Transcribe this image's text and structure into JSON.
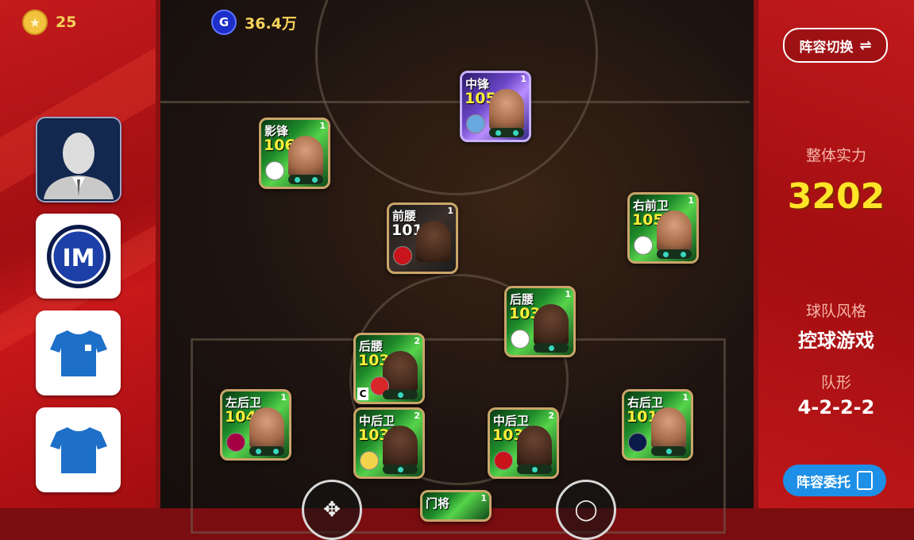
{
  "currency": {
    "coins": {
      "icon": "star-coin-icon",
      "value": "25"
    },
    "gp": {
      "icon": "gp-icon",
      "symbol": "G",
      "value": "36.4万"
    }
  },
  "left_menu": [
    {
      "name": "manager",
      "icon": "manager-silhouette-icon"
    },
    {
      "name": "club-crest",
      "icon": "inter-crest-icon"
    },
    {
      "name": "home-kit",
      "icon": "shirt-icon"
    },
    {
      "name": "away-kit",
      "icon": "shirt-icon"
    }
  ],
  "right_panel": {
    "switch_label": "阵容切换",
    "overall_label": "整体实力",
    "overall_value": "3202",
    "style_label": "球队风格",
    "style_value": "控球游戏",
    "formation_label": "队形",
    "formation_value": "4-2-2-2",
    "delegate_label": "阵容委托"
  },
  "players": [
    {
      "id": "cf",
      "position": "中锋",
      "rating": "105",
      "level": "1",
      "style": "purple"
    },
    {
      "id": "ss",
      "position": "影锋",
      "rating": "106",
      "level": "1",
      "style": "green"
    },
    {
      "id": "am",
      "position": "前腰",
      "rating": "101",
      "level": "1",
      "style": "dark"
    },
    {
      "id": "rm",
      "position": "右前卫",
      "rating": "105",
      "level": "1",
      "style": "green"
    },
    {
      "id": "dmr",
      "position": "后腰",
      "rating": "103",
      "level": "1",
      "style": "green"
    },
    {
      "id": "dml",
      "position": "后腰",
      "rating": "103",
      "level": "2",
      "style": "green",
      "captain": "C"
    },
    {
      "id": "lb",
      "position": "左后卫",
      "rating": "104",
      "level": "1",
      "style": "green"
    },
    {
      "id": "cbl",
      "position": "中后卫",
      "rating": "103",
      "level": "2",
      "style": "green"
    },
    {
      "id": "cbr",
      "position": "中后卫",
      "rating": "103",
      "level": "2",
      "style": "green"
    },
    {
      "id": "rb",
      "position": "右后卫",
      "rating": "101",
      "level": "1",
      "style": "green"
    },
    {
      "id": "gk",
      "position": "门将",
      "rating": "",
      "level": "1",
      "style": "green"
    }
  ],
  "bottom_controls": {
    "move_icon": "move-arrows-icon",
    "player_icon": "player-icon"
  }
}
